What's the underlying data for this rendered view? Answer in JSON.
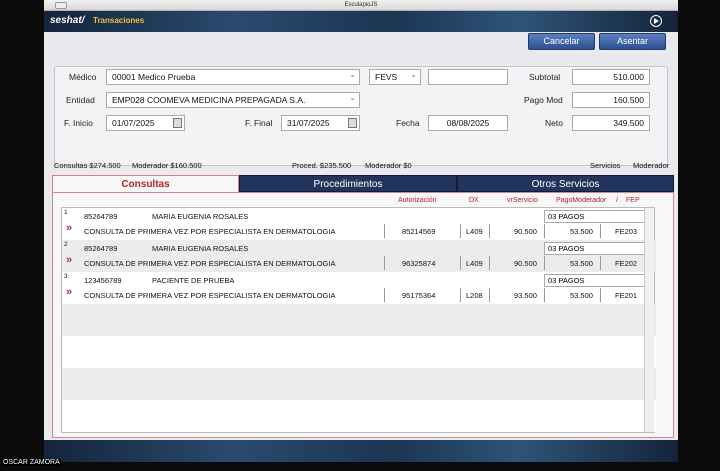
{
  "window": {
    "title": "EsculapioJS"
  },
  "header": {
    "brand": "seshat/",
    "section": "Transaciones"
  },
  "toolbar": {
    "cancel_label": "Cancelar",
    "submit_label": "Asentar"
  },
  "form": {
    "medico_label": "Médico",
    "medico_value": "00001 Medico Prueba",
    "entidad_label": "Entidad",
    "entidad_value": "EMP028 COOMEVA MEDICINA PREPAGADA S.A.",
    "type_value": "FEVS",
    "extra_value": "",
    "f_inicio_label": "F. Inicio",
    "f_inicio_value": "01/07/2025",
    "f_final_label": "F. Final",
    "f_final_value": "31/07/2025",
    "fecha_label": "Fecha",
    "fecha_value": "08/08/2025",
    "subtotal_label": "Subtotal",
    "subtotal_value": "510.000",
    "pago_mod_label": "Pago Mod",
    "pago_mod_value": "160.500",
    "neto_label": "Neto",
    "neto_value": "349.500"
  },
  "summary": {
    "consultas": "Consultas $274.500",
    "moderador": "Moderador $160.500",
    "proced": "Proced. $235.500",
    "proced_mod": "Moderador $0",
    "servicios": "Servicios",
    "servicios_mod": "Moderador"
  },
  "tabs": [
    "Consultas",
    "Procedimientos",
    "Otros Servicios"
  ],
  "columns": {
    "autorizacion": "Autorización",
    "dx": "DX",
    "vr_servicio": "vrServicio",
    "pago_moderador": "PagoModerador",
    "slash": "/",
    "fep": "FEP"
  },
  "rows": [
    {
      "num": "1",
      "id": "85264789",
      "name": "MARIA EUGENIA ROSALES",
      "pago": "03  PAGOS",
      "desc": "CONSULTA DE PRIMERA VEZ POR ESPECIALISTA EN DERMATOLOGIA",
      "auth": "85214569",
      "dx": "L409",
      "vr": "90.500",
      "mod": "53.500",
      "fep": "FE203"
    },
    {
      "num": "2",
      "id": "85264789",
      "name": "MARIA EUGENIA ROSALES",
      "pago": "03  PAGOS",
      "desc": "CONSULTA DE PRIMERA VEZ POR ESPECIALISTA EN DERMATOLOGIA",
      "auth": "96325874",
      "dx": "L409",
      "vr": "90.500",
      "mod": "53.500",
      "fep": "FE202"
    },
    {
      "num": "3",
      "id": "123456789",
      "name": "PACIENTE DE PRUEBA",
      "pago": "03  PAGOS",
      "desc": "CONSULTA DE PRIMERA VEZ POR ESPECIALISTA EN DERMATOLOGIA",
      "auth": "95175364",
      "dx": "L208",
      "vr": "93.500",
      "mod": "53.500",
      "fep": "FE201"
    }
  ],
  "caption": "OSCAR ZAMORA"
}
